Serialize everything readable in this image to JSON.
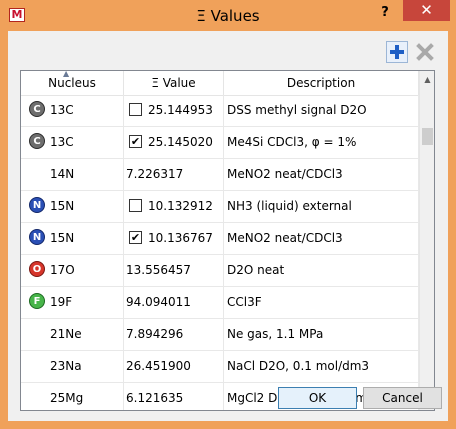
{
  "window": {
    "title": "Ξ Values",
    "app_icon_letter": "M",
    "help_label": "?",
    "close_label": "✕"
  },
  "toolbar": {
    "add_icon": "plus-icon",
    "delete_icon": "x-icon",
    "colors": {
      "add": "#1f5fc5",
      "delete_disabled": "#a9a9a9"
    }
  },
  "table": {
    "headers": {
      "nucleus": "Nucleus",
      "value": "Ξ Value",
      "description": "Description"
    },
    "sorted_column": "nucleus",
    "rows": [
      {
        "icon": "C",
        "nucleus": "13C",
        "checkbox": true,
        "checked": false,
        "value": "25.144953",
        "description": "DSS methyl signal D2O"
      },
      {
        "icon": "C",
        "nucleus": "13C",
        "checkbox": true,
        "checked": true,
        "value": "25.145020",
        "description": "Me4Si CDCl3, φ = 1%"
      },
      {
        "icon": "",
        "nucleus": "14N",
        "checkbox": false,
        "checked": false,
        "value": "7.226317",
        "description": "MeNO2 neat/CDCl3"
      },
      {
        "icon": "N",
        "nucleus": "15N",
        "checkbox": true,
        "checked": false,
        "value": "10.132912",
        "description": "NH3 (liquid) external"
      },
      {
        "icon": "N",
        "nucleus": "15N",
        "checkbox": true,
        "checked": true,
        "value": "10.136767",
        "description": "MeNO2 neat/CDCl3"
      },
      {
        "icon": "O",
        "nucleus": "17O",
        "checkbox": false,
        "checked": false,
        "value": "13.556457",
        "description": "D2O neat"
      },
      {
        "icon": "F",
        "nucleus": "19F",
        "checkbox": false,
        "checked": false,
        "value": "94.094011",
        "description": "CCl3F"
      },
      {
        "icon": "",
        "nucleus": "21Ne",
        "checkbox": false,
        "checked": false,
        "value": "7.894296",
        "description": "Ne gas, 1.1 MPa"
      },
      {
        "icon": "",
        "nucleus": "23Na",
        "checkbox": false,
        "checked": false,
        "value": "26.451900",
        "description": "NaCl D2O, 0.1 mol/dm3"
      },
      {
        "icon": "",
        "nucleus": "25Mg",
        "checkbox": false,
        "checked": false,
        "value": "6.121635",
        "description": "MgCl2 D2O, 11 mol/dm3"
      }
    ]
  },
  "buttons": {
    "ok": "OK",
    "cancel": "Cancel"
  }
}
